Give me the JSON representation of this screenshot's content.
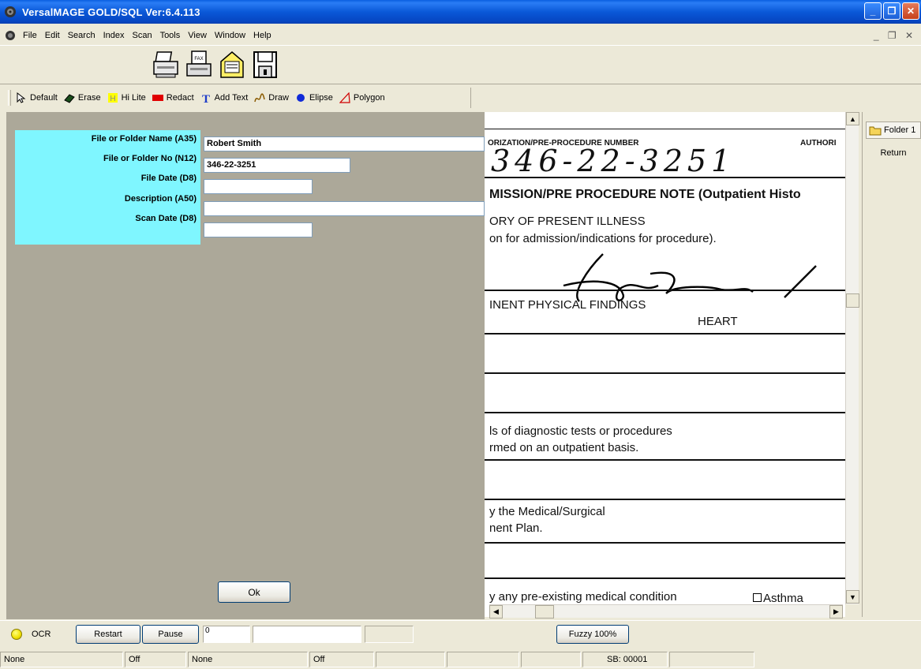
{
  "window": {
    "title": "VersalMAGE GOLD/SQL Ver:6.4.113",
    "minimize_glyph": "_",
    "maximize_glyph": "❐",
    "close_glyph": "✕",
    "mdi_controls": "_ ❐ ✕"
  },
  "menu": {
    "items": [
      "File",
      "Edit",
      "Search",
      "Index",
      "Scan",
      "Tools",
      "View",
      "Window",
      "Help"
    ]
  },
  "toolbar_icons": [
    "printer-icon",
    "fax-icon",
    "mail-envelope-icon",
    "save-disk-icon"
  ],
  "annotation_tools": [
    {
      "label": "Default",
      "icon": "cursor-arrow-icon"
    },
    {
      "label": "Erase",
      "icon": "eraser-icon"
    },
    {
      "label": "Hi Lite",
      "icon": "highlight-icon"
    },
    {
      "label": "Redact",
      "icon": "redact-icon"
    },
    {
      "label": "Add Text",
      "icon": "text-icon"
    },
    {
      "label": "Draw",
      "icon": "draw-icon"
    },
    {
      "label": "Elipse",
      "icon": "ellipse-icon"
    },
    {
      "label": "Polygon",
      "icon": "polygon-icon"
    }
  ],
  "form": {
    "fields": [
      {
        "label": "File or Folder Name (A35)",
        "value": "Robert Smith"
      },
      {
        "label": "File or Folder No (N12)",
        "value": "346-22-3251"
      },
      {
        "label": "File Date (D8)",
        "value": ""
      },
      {
        "label": "Description (A50)",
        "value": ""
      },
      {
        "label": "Scan Date (D8)",
        "value": ""
      }
    ],
    "ok_label": "Ok"
  },
  "document": {
    "header_label": "ORIZATION/PRE-PROCEDURE NUMBER",
    "header_right": "AUTHORI",
    "handwritten_number": "346-22-3251",
    "title": "MISSION/PRE PROCEDURE NOTE (Outpatient Histo",
    "section1": "ORY OF PRESENT ILLNESS",
    "section1_sub": "on for admission/indications for procedure).",
    "section2": "INENT PHYSICAL FINDINGS",
    "heart": "HEART",
    "line_a1": "ls of diagnostic tests or procedures",
    "line_a2": "rmed on an outpatient basis.",
    "line_b1": "y the Medical/Surgical",
    "line_b2": "nent Plan.",
    "line_c": "y any pre-existing medical condition",
    "checkbox_label": "Asthma"
  },
  "side_panel": {
    "tab_label": "Folder 1",
    "return_label": "Return"
  },
  "bottom": {
    "ocr_label": "OCR",
    "restart_label": "Restart",
    "pause_label": "Pause",
    "counter_value": "0",
    "fuzzy_label": "Fuzzy 100%"
  },
  "status": {
    "cells": [
      "None",
      "Off",
      "None",
      "Off",
      "",
      "",
      "",
      "SB: 00001",
      ""
    ]
  }
}
